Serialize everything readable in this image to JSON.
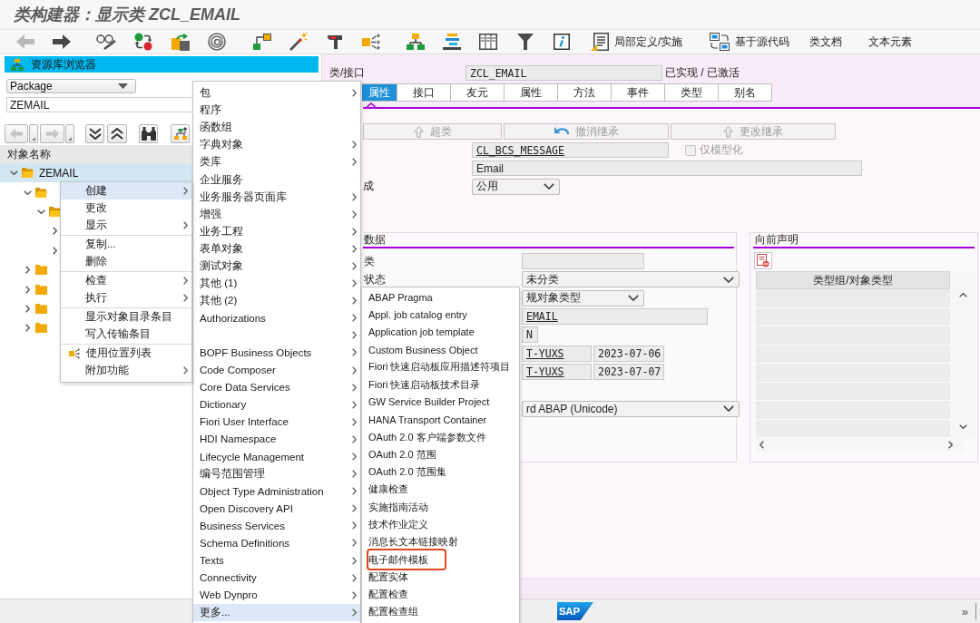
{
  "window": {
    "title": "类构建器：显示类 ZCL_EMAIL"
  },
  "toolbar": {
    "back": {
      "disabled": true
    },
    "forward": {
      "disabled": false
    },
    "text_buttons": [
      {
        "label": "局部定义/实施",
        "kind": "local"
      },
      {
        "label": "基于源代码",
        "kind": "source"
      },
      {
        "label": "类文档",
        "kind": "plain"
      },
      {
        "label": "文本元素",
        "kind": "plain"
      }
    ]
  },
  "repository_browser": {
    "title": "资源库浏览器",
    "object_type": "Package",
    "object_name": "ZEMAIL",
    "history": {
      "back": {
        "disabled": true
      },
      "forward": {
        "disabled": true
      }
    },
    "column_header": "对象名称",
    "tree": [
      {
        "label": "ZEMAIL",
        "kind": "folder",
        "expanded": true,
        "selected": true,
        "children": [
          {
            "kind": "folder",
            "expanded": true,
            "selected": false,
            "children": [
              {
                "kind": "folder",
                "expanded": true,
                "selected": false,
                "children": [
                  {
                    "expanded": false,
                    "selected": false
                  },
                  {
                    "expanded": false,
                    "selected": false
                  }
                ]
              }
            ]
          },
          {
            "kind": "folder",
            "expanded": false,
            "selected": false
          },
          {
            "kind": "folder",
            "expanded": false,
            "selected": false
          },
          {
            "kind": "folder",
            "expanded": false,
            "selected": false
          },
          {
            "kind": "folder",
            "expanded": false,
            "selected": false
          }
        ]
      }
    ]
  },
  "context_menu": {
    "groups": [
      {
        "items": [
          {
            "label": "创建",
            "kind": "plain",
            "submenu": true,
            "selected": true
          },
          {
            "label": "更改",
            "kind": "plain",
            "submenu": false,
            "selected": false
          },
          {
            "label": "显示",
            "kind": "plain",
            "submenu": true,
            "selected": false
          }
        ]
      },
      {
        "items": [
          {
            "label": "复制...",
            "kind": "plain",
            "submenu": false,
            "selected": false
          },
          {
            "label": "删除",
            "kind": "plain",
            "submenu": false,
            "selected": false
          }
        ]
      },
      {
        "items": [
          {
            "label": "检查",
            "kind": "plain",
            "submenu": true,
            "selected": false
          },
          {
            "label": "执行",
            "kind": "plain",
            "submenu": true,
            "selected": false
          }
        ]
      },
      {
        "items": [
          {
            "label": "显示对象目录条目",
            "kind": "plain",
            "submenu": false,
            "selected": false
          },
          {
            "label": "写入传输条目",
            "kind": "plain",
            "submenu": false,
            "selected": false
          }
        ]
      },
      {
        "items": [
          {
            "label": "使用位置列表",
            "kind": "icon",
            "submenu": false,
            "selected": false
          },
          {
            "label": "附加功能",
            "kind": "plain",
            "submenu": true,
            "selected": false
          }
        ]
      }
    ]
  },
  "create_menu": {
    "items": [
      {
        "label": "包",
        "submenu": true,
        "selected": false
      },
      {
        "label": "程序",
        "submenu": false,
        "selected": false
      },
      {
        "label": "函数组",
        "submenu": false,
        "selected": false
      },
      {
        "label": "字典对象",
        "submenu": true,
        "selected": false
      },
      {
        "label": "类库",
        "submenu": true,
        "selected": false
      },
      {
        "label": "企业服务",
        "submenu": false,
        "selected": false
      },
      {
        "label": "业务服务器页面库",
        "submenu": true,
        "selected": false
      },
      {
        "label": "增强",
        "submenu": true,
        "selected": false
      },
      {
        "label": "业务工程",
        "submenu": true,
        "selected": false
      },
      {
        "label": "表单对象",
        "submenu": true,
        "selected": false
      },
      {
        "label": "测试对象",
        "submenu": true,
        "selected": false
      },
      {
        "label": "其他 (1)",
        "submenu": true,
        "selected": false
      },
      {
        "label": "其他 (2)",
        "submenu": true,
        "selected": false
      },
      {
        "label": "Authorizations",
        "submenu": true,
        "selected": false
      },
      {
        "submenu": true,
        "selected": false
      },
      {
        "label": "BOPF Business Objects",
        "submenu": true,
        "selected": false
      },
      {
        "label": "Code Composer",
        "submenu": true,
        "selected": false
      },
      {
        "label": "Core Data Services",
        "submenu": true,
        "selected": false
      },
      {
        "label": "Dictionary",
        "submenu": true,
        "selected": false
      },
      {
        "label": "Fiori User Interface",
        "submenu": true,
        "selected": false
      },
      {
        "label": "HDI Namespace",
        "submenu": true,
        "selected": false
      },
      {
        "label": "Lifecycle Management",
        "submenu": true,
        "selected": false
      },
      {
        "label": "编号范围管理",
        "submenu": true,
        "selected": false
      },
      {
        "label": "Object Type Administration",
        "submenu": true,
        "selected": false
      },
      {
        "label": "Open Discovery API",
        "submenu": true,
        "selected": false
      },
      {
        "label": "Business Services",
        "submenu": true,
        "selected": false
      },
      {
        "label": "Schema Definitions",
        "submenu": true,
        "selected": false
      },
      {
        "label": "Texts",
        "submenu": true,
        "selected": false
      },
      {
        "label": "Connectivity",
        "submenu": true,
        "selected": false
      },
      {
        "label": "Web Dynpro",
        "submenu": true,
        "selected": false
      },
      {
        "label": "更多...",
        "submenu": true,
        "selected": true
      }
    ]
  },
  "more_menu": {
    "items": [
      {
        "label": "ABAP Pragma",
        "selected": false,
        "outlined": false
      },
      {
        "label": "Appl. job catalog entry",
        "selected": false,
        "outlined": false
      },
      {
        "label": "Application job template",
        "selected": false,
        "outlined": false
      },
      {
        "label": "Custom Business Object",
        "selected": false,
        "outlined": false
      },
      {
        "label": "Fiori 快速启动板应用描述符项目",
        "selected": false,
        "outlined": false
      },
      {
        "label": "Fiori 快速启动板技术目录",
        "selected": false,
        "outlined": false
      },
      {
        "label": "GW Service Builder Project",
        "selected": false,
        "outlined": false
      },
      {
        "label": "HANA Transport Container",
        "selected": false,
        "outlined": false
      },
      {
        "label": "OAuth 2.0 客户端参数文件",
        "selected": false,
        "outlined": false
      },
      {
        "label": "OAuth 2.0 范围",
        "selected": false,
        "outlined": false
      },
      {
        "label": "OAuth 2.0 范围集",
        "selected": false,
        "outlined": false
      },
      {
        "label": "健康检查",
        "selected": false,
        "outlined": false
      },
      {
        "label": "实施指南活动",
        "selected": false,
        "outlined": false
      },
      {
        "label": "技术作业定义",
        "selected": false,
        "outlined": false
      },
      {
        "label": "消息长文本链接映射",
        "selected": false,
        "outlined": false
      },
      {
        "label": "电子邮件模板",
        "selected": false,
        "outlined": true
      },
      {
        "label": "配置实体",
        "selected": false,
        "outlined": false
      },
      {
        "label": "配置检查",
        "selected": false,
        "outlined": false
      },
      {
        "label": "配置检查组",
        "selected": false,
        "outlined": false
      }
    ]
  },
  "class_header": {
    "label": "类/接口",
    "name": "ZCL_EMAIL",
    "status": "已实现 / 已激活"
  },
  "tabs": [
    {
      "label": "属性",
      "selected": true
    },
    {
      "label": "接口",
      "selected": false
    },
    {
      "label": "友元",
      "selected": false
    },
    {
      "label": "属性",
      "selected": false
    },
    {
      "label": "方法",
      "selected": false
    },
    {
      "label": "事件",
      "selected": false
    },
    {
      "label": "类型",
      "selected": false
    },
    {
      "label": "别名",
      "selected": false
    }
  ],
  "inheritance_buttons": [
    {
      "label": "超类",
      "kind": "superclass",
      "disabled": true
    },
    {
      "label": "撤消继承",
      "kind": "undo",
      "disabled": true
    },
    {
      "label": "更改继承",
      "kind": "change",
      "disabled": true
    }
  ],
  "properties": {
    "superclass": {
      "value": "CL_BCS_MESSAGE",
      "linked": true
    },
    "modeled_only": {
      "label": "仅模型化",
      "checked": false,
      "disabled": true
    },
    "description": {
      "value": "Email"
    },
    "instantiation": {
      "label": "成",
      "value": "公用"
    }
  },
  "general_data": {
    "title": "数据",
    "rows": [
      {
        "kind": "field",
        "label": "类"
      },
      {
        "kind": "select_wide",
        "label": "状态",
        "value": "未分类"
      },
      {
        "kind": "select",
        "value": "规对象类型"
      },
      {
        "kind": "field_long",
        "value": "EMAIL",
        "linked": true
      },
      {
        "kind": "field_short",
        "value": "N",
        "linked": false
      },
      {
        "kind": "pair",
        "value": "T-YUXS",
        "date": "2023-07-06",
        "linked": true
      },
      {
        "kind": "pair",
        "value": "T-YUXS",
        "date": "2023-07-07",
        "linked": true
      },
      {
        "kind": "blank"
      },
      {
        "kind": "select_wide",
        "value": "rd ABAP (Unicode)"
      }
    ]
  },
  "forward_declarations": {
    "title": "向前声明",
    "column": "类型组/对象类型"
  },
  "status_bar": {
    "logo": "SAP",
    "overflow": "»"
  }
}
